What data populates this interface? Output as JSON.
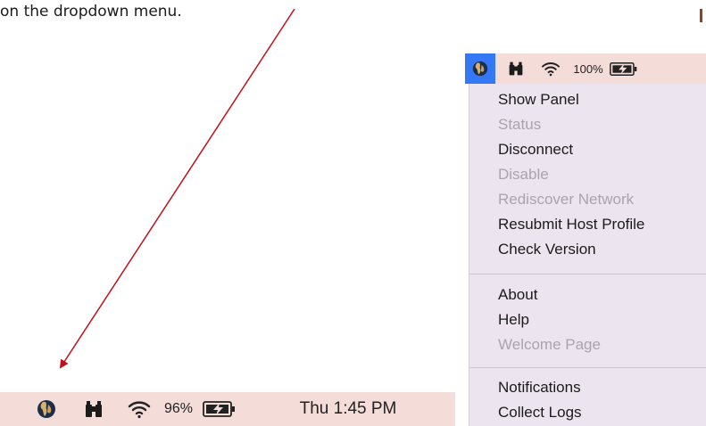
{
  "caption": {
    "text": "on the dropdown menu."
  },
  "bottom_bar": {
    "battery_percent": "96%",
    "clock": "Thu 1:45 PM",
    "icons": [
      "globe-app-icon",
      "binoculars-icon",
      "wifi-icon",
      "battery-charging-icon"
    ]
  },
  "top_bar": {
    "battery_percent": "100%",
    "icons": [
      "globe-app-icon",
      "binoculars-icon",
      "wifi-icon",
      "battery-charging-icon"
    ]
  },
  "menu": {
    "groups": [
      {
        "items": [
          {
            "label": "Show Panel",
            "enabled": true
          },
          {
            "label": "Status",
            "enabled": false
          },
          {
            "label": "Disconnect",
            "enabled": true
          },
          {
            "label": "Disable",
            "enabled": false
          },
          {
            "label": "Rediscover Network",
            "enabled": false
          },
          {
            "label": "Resubmit Host Profile",
            "enabled": true
          },
          {
            "label": "Check Version",
            "enabled": true
          }
        ]
      },
      {
        "items": [
          {
            "label": "About",
            "enabled": true
          },
          {
            "label": "Help",
            "enabled": true
          },
          {
            "label": "Welcome Page",
            "enabled": false
          }
        ]
      },
      {
        "items": [
          {
            "label": "Notifications",
            "enabled": true
          },
          {
            "label": "Collect Logs",
            "enabled": true
          }
        ]
      }
    ]
  },
  "colors": {
    "menubar_bg": "#f4dcd8",
    "menu_bg": "#ece4ee",
    "highlight": "#3478f6",
    "arrow": "#c0101a",
    "disabled_text": "#aaa4ad"
  }
}
